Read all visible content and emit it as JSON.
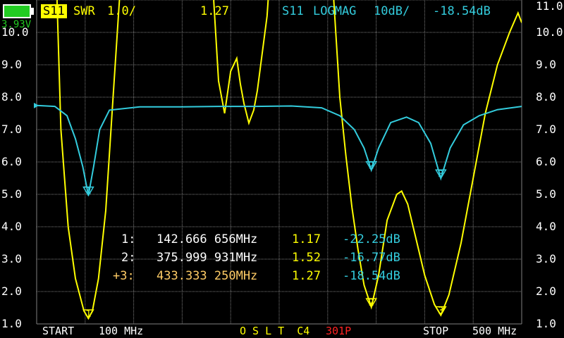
{
  "colors": {
    "background": "#000000",
    "grid": "#808080",
    "trace_swr": "#ffff00",
    "trace_logmag": "#33ccdd",
    "text": "#ffffff",
    "battery": "#22cc22",
    "points_count": "#ff2222",
    "active_marker": "#ffcc66"
  },
  "status": {
    "battery_voltage": "3.93V"
  },
  "header": {
    "trace1_channel": "S11",
    "trace1_format": "SWR",
    "trace1_scale": "1.0/",
    "trace1_value": "1.27",
    "trace2_channel": "S11",
    "trace2_format": "LOGMAG",
    "trace2_scale": "10dB/",
    "trace2_value": "-18.54dB"
  },
  "y_labels_left": [
    "10.0",
    "9.0",
    "8.0",
    "7.0",
    "6.0",
    "5.0",
    "4.0",
    "3.0",
    "2.0",
    "1.0"
  ],
  "y_labels_right": [
    "11.0",
    "10.0",
    "9.0",
    "8.0",
    "7.0",
    "6.0",
    "5.0",
    "4.0",
    "3.0",
    "2.0",
    "1.0"
  ],
  "markers": [
    {
      "id": "1:",
      "freq": "142.666 656MHz",
      "swr": "1.17",
      "logmag": "-22.25dB"
    },
    {
      "id": "2:",
      "freq": "375.999 931MHz",
      "swr": "1.52",
      "logmag": "-16.77dB"
    },
    {
      "id": "+3:",
      "freq": "433.333 250MHz",
      "swr": "1.27",
      "logmag": "-18.54dB"
    }
  ],
  "footer": {
    "start_label": "START",
    "start_value": "100 MHz",
    "cal_status": "O S L T  C4",
    "points": "301P",
    "stop_label": "STOP",
    "stop_value": "500 MHz"
  },
  "chart_data": {
    "type": "line",
    "x_range_mhz": [
      100,
      500
    ],
    "grid": true,
    "series": [
      {
        "name": "S11 SWR",
        "ylim": [
          1,
          11
        ],
        "points_mhz": [
          [
            100,
            20
          ],
          [
            110,
            17
          ],
          [
            116,
            12
          ],
          [
            120,
            7
          ],
          [
            126,
            4
          ],
          [
            132,
            2.4
          ],
          [
            139,
            1.4
          ],
          [
            142.7,
            1.17
          ],
          [
            146,
            1.4
          ],
          [
            151,
            2.4
          ],
          [
            157,
            4.5
          ],
          [
            163,
            8
          ],
          [
            170,
            12
          ],
          [
            178,
            16
          ],
          [
            185,
            20
          ],
          [
            235,
            20
          ],
          [
            240,
            15
          ],
          [
            246,
            11
          ],
          [
            250,
            8.5
          ],
          [
            255,
            7.5
          ],
          [
            260,
            8.8
          ],
          [
            265,
            9.2
          ],
          [
            268,
            8.4
          ],
          [
            271,
            7.8
          ],
          [
            275,
            7.2
          ],
          [
            279,
            7.6
          ],
          [
            282,
            8.2
          ],
          [
            290,
            10.5
          ],
          [
            300,
            16
          ],
          [
            305,
            20
          ],
          [
            340,
            16
          ],
          [
            345,
            11
          ],
          [
            350,
            8
          ],
          [
            355,
            6.2
          ],
          [
            360,
            4.6
          ],
          [
            365,
            3.3
          ],
          [
            370,
            2.2
          ],
          [
            376,
            1.52
          ],
          [
            382,
            2.5
          ],
          [
            389,
            4.2
          ],
          [
            397,
            5.0
          ],
          [
            401,
            5.1
          ],
          [
            406,
            4.7
          ],
          [
            413,
            3.6
          ],
          [
            420,
            2.5
          ],
          [
            428,
            1.6
          ],
          [
            433.3,
            1.27
          ],
          [
            440,
            1.9
          ],
          [
            450,
            3.5
          ],
          [
            460,
            5.5
          ],
          [
            470,
            7.5
          ],
          [
            480,
            9.0
          ],
          [
            490,
            10.0
          ],
          [
            497,
            10.6
          ],
          [
            500,
            10.3
          ]
        ]
      },
      {
        "name": "S11 LOGMAG",
        "ylim_db": [
          -50,
          20
        ],
        "points_mhz": [
          [
            100,
            -2.8
          ],
          [
            115,
            -3.0
          ],
          [
            125,
            -5
          ],
          [
            132,
            -10
          ],
          [
            138,
            -16
          ],
          [
            142.7,
            -22.25
          ],
          [
            147,
            -16
          ],
          [
            152,
            -8
          ],
          [
            160,
            -3.8
          ],
          [
            185,
            -3.1
          ],
          [
            220,
            -3.1
          ],
          [
            250,
            -3.0
          ],
          [
            280,
            -3.0
          ],
          [
            310,
            -2.9
          ],
          [
            335,
            -3.3
          ],
          [
            350,
            -5
          ],
          [
            362,
            -8
          ],
          [
            370,
            -12
          ],
          [
            376,
            -16.77
          ],
          [
            382,
            -12
          ],
          [
            392,
            -6.5
          ],
          [
            405,
            -5.3
          ],
          [
            415,
            -6.5
          ],
          [
            425,
            -11
          ],
          [
            433.3,
            -18.54
          ],
          [
            441,
            -12
          ],
          [
            452,
            -7
          ],
          [
            465,
            -5
          ],
          [
            480,
            -3.7
          ],
          [
            500,
            -3.0
          ]
        ]
      }
    ],
    "marker_points": [
      {
        "label": "1",
        "freq_mhz": 142.666656,
        "swr": 1.17,
        "logmag_db": -22.25
      },
      {
        "label": "2",
        "freq_mhz": 375.999931,
        "swr": 1.52,
        "logmag_db": -16.77
      },
      {
        "label": "3",
        "freq_mhz": 433.33325,
        "swr": 1.27,
        "logmag_db": -18.54
      }
    ]
  }
}
